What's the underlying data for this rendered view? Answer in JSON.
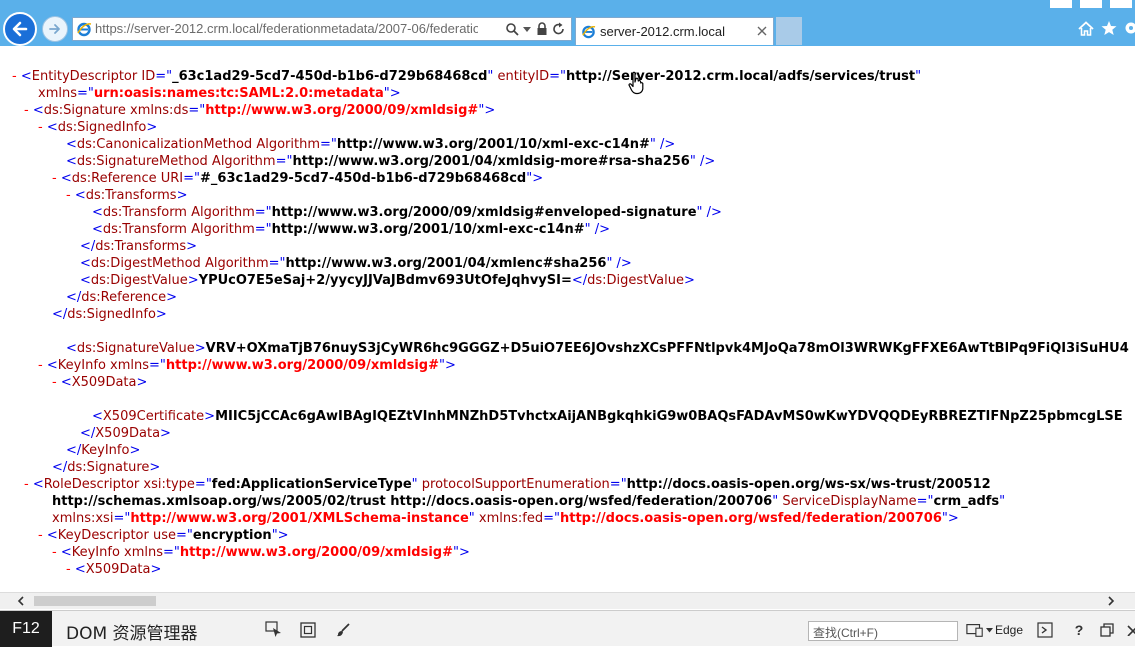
{
  "browser": {
    "address_url": "https://server-2012.crm.local/federationmetadata/2007-06/federation",
    "tab_title": "server-2012.crm.local"
  },
  "xml_lines": [
    [
      [
        "mk",
        "- "
      ],
      [
        "blue",
        "<"
      ],
      [
        "tg",
        "EntityDescriptor "
      ],
      [
        "atr",
        "ID"
      ],
      [
        "blue",
        "=\""
      ],
      [
        "vl",
        "_63c1ad29-5cd7-450d-b1b6-d729b68468cd"
      ],
      [
        "blue",
        "\" "
      ],
      [
        "atr",
        "entityID"
      ],
      [
        "blue",
        "=\""
      ],
      [
        "vl",
        "http://Server-2012.crm.local/adfs/services/trust"
      ],
      [
        "blue",
        "\""
      ]
    ],
    [
      [
        "atr",
        "xmlns"
      ],
      [
        "blue",
        "=\""
      ],
      [
        "ns",
        "urn:oasis:names:tc:SAML:2.0:metadata"
      ],
      [
        "blue",
        "\">"
      ]
    ],
    [
      [
        "mk",
        "- "
      ],
      [
        "blue",
        "<"
      ],
      [
        "tg",
        "ds:Signature "
      ],
      [
        "atr",
        "xmlns:ds"
      ],
      [
        "blue",
        "=\""
      ],
      [
        "ns",
        "http://www.w3.org/2000/09/xmldsig#"
      ],
      [
        "blue",
        "\">"
      ]
    ],
    [
      [
        "mk",
        "- "
      ],
      [
        "blue",
        "<"
      ],
      [
        "tg",
        "ds:SignedInfo"
      ],
      [
        "blue",
        ">"
      ]
    ],
    [
      [
        "blue",
        "<"
      ],
      [
        "tg",
        "ds:CanonicalizationMethod "
      ],
      [
        "atr",
        "Algorithm"
      ],
      [
        "blue",
        "=\""
      ],
      [
        "vl",
        "http://www.w3.org/2001/10/xml-exc-c14n#"
      ],
      [
        "blue",
        "\" />"
      ]
    ],
    [
      [
        "blue",
        "<"
      ],
      [
        "tg",
        "ds:SignatureMethod "
      ],
      [
        "atr",
        "Algorithm"
      ],
      [
        "blue",
        "=\""
      ],
      [
        "vl",
        "http://www.w3.org/2001/04/xmldsig-more#rsa-sha256"
      ],
      [
        "blue",
        "\" />"
      ]
    ],
    [
      [
        "mk",
        "- "
      ],
      [
        "blue",
        "<"
      ],
      [
        "tg",
        "ds:Reference "
      ],
      [
        "atr",
        "URI"
      ],
      [
        "blue",
        "=\""
      ],
      [
        "vl",
        "#_63c1ad29-5cd7-450d-b1b6-d729b68468cd"
      ],
      [
        "blue",
        "\">"
      ]
    ],
    [
      [
        "mk",
        "- "
      ],
      [
        "blue",
        "<"
      ],
      [
        "tg",
        "ds:Transforms"
      ],
      [
        "blue",
        ">"
      ]
    ],
    [
      [
        "blue",
        "<"
      ],
      [
        "tg",
        "ds:Transform "
      ],
      [
        "atr",
        "Algorithm"
      ],
      [
        "blue",
        "=\""
      ],
      [
        "vl",
        "http://www.w3.org/2000/09/xmldsig#enveloped-signature"
      ],
      [
        "blue",
        "\" />"
      ]
    ],
    [
      [
        "blue",
        "<"
      ],
      [
        "tg",
        "ds:Transform "
      ],
      [
        "atr",
        "Algorithm"
      ],
      [
        "blue",
        "=\""
      ],
      [
        "vl",
        "http://www.w3.org/2001/10/xml-exc-c14n#"
      ],
      [
        "blue",
        "\" />"
      ]
    ],
    [
      [
        "blue",
        "</"
      ],
      [
        "tg",
        "ds:Transforms"
      ],
      [
        "blue",
        ">"
      ]
    ],
    [
      [
        "blue",
        "<"
      ],
      [
        "tg",
        "ds:DigestMethod "
      ],
      [
        "atr",
        "Algorithm"
      ],
      [
        "blue",
        "=\""
      ],
      [
        "vl",
        "http://www.w3.org/2001/04/xmlenc#sha256"
      ],
      [
        "blue",
        "\" />"
      ]
    ],
    [
      [
        "blue",
        "<"
      ],
      [
        "tg",
        "ds:DigestValue"
      ],
      [
        "blue",
        ">"
      ],
      [
        "vl",
        "YPUcO7E5eSaj+2/yycyJJVaJBdmv693UtOfeJqhvySI="
      ],
      [
        "blue",
        "</"
      ],
      [
        "tg",
        "ds:DigestValue"
      ],
      [
        "blue",
        ">"
      ]
    ],
    [
      [
        "blue",
        "</"
      ],
      [
        "tg",
        "ds:Reference"
      ],
      [
        "blue",
        ">"
      ]
    ],
    [
      [
        "blue",
        "</"
      ],
      [
        "tg",
        "ds:SignedInfo"
      ],
      [
        "blue",
        ">"
      ]
    ],
    [
      [
        "blue",
        "<"
      ],
      [
        "tg",
        "ds:SignatureValue"
      ],
      [
        "blue",
        ">"
      ],
      [
        "vl",
        "VRV+OXmaTjB76nuyS3jCyWR6hc9GGGZ+D5uiO7EE6JOvshzXCsPFFNtlpvk4MJoQa78mOl3WRWKgFFXE6AwTtBlPq9FiQI3iSuHU4"
      ]
    ],
    [
      [
        "mk",
        "- "
      ],
      [
        "blue",
        "<"
      ],
      [
        "tg",
        "KeyInfo "
      ],
      [
        "atr",
        "xmlns"
      ],
      [
        "blue",
        "=\""
      ],
      [
        "ns",
        "http://www.w3.org/2000/09/xmldsig#"
      ],
      [
        "blue",
        "\">"
      ]
    ],
    [
      [
        "mk",
        "- "
      ],
      [
        "blue",
        "<"
      ],
      [
        "tg",
        "X509Data"
      ],
      [
        "blue",
        ">"
      ]
    ],
    [
      [
        "blue",
        "<"
      ],
      [
        "tg",
        "X509Certificate"
      ],
      [
        "blue",
        ">"
      ],
      [
        "vl",
        "MIIC5jCCAc6gAwIBAgIQEZtVInhMNZhD5TvhctxAijANBgkqhkiG9w0BAQsFADAvMS0wKwYDVQQDEyRBREZTIFNpZ25pbmcgLSE"
      ]
    ],
    [
      [
        "blue",
        "</"
      ],
      [
        "tg",
        "X509Data"
      ],
      [
        "blue",
        ">"
      ]
    ],
    [
      [
        "blue",
        "</"
      ],
      [
        "tg",
        "KeyInfo"
      ],
      [
        "blue",
        ">"
      ]
    ],
    [
      [
        "blue",
        "</"
      ],
      [
        "tg",
        "ds:Signature"
      ],
      [
        "blue",
        ">"
      ]
    ],
    [
      [
        "mk",
        "- "
      ],
      [
        "blue",
        "<"
      ],
      [
        "tg",
        "RoleDescriptor "
      ],
      [
        "atr",
        "xsi:type"
      ],
      [
        "blue",
        "=\""
      ],
      [
        "vl",
        "fed:ApplicationServiceType"
      ],
      [
        "blue",
        "\" "
      ],
      [
        "atr",
        "protocolSupportEnumeration"
      ],
      [
        "blue",
        "=\""
      ],
      [
        "vl",
        "http://docs.oasis-open.org/ws-sx/ws-trust/200512"
      ]
    ],
    [
      [
        "vl",
        "http://schemas.xmlsoap.org/ws/2005/02/trust http://docs.oasis-open.org/wsfed/federation/200706"
      ],
      [
        "blue",
        "\" "
      ],
      [
        "atr",
        "ServiceDisplayName"
      ],
      [
        "blue",
        "=\""
      ],
      [
        "vl",
        "crm_adfs"
      ],
      [
        "blue",
        "\""
      ]
    ],
    [
      [
        "atr",
        "xmlns:xsi"
      ],
      [
        "blue",
        "=\""
      ],
      [
        "ns",
        "http://www.w3.org/2001/XMLSchema-instance"
      ],
      [
        "blue",
        "\" "
      ],
      [
        "atr",
        "xmlns:fed"
      ],
      [
        "blue",
        "=\""
      ],
      [
        "ns",
        "http://docs.oasis-open.org/wsfed/federation/200706"
      ],
      [
        "blue",
        "\">"
      ]
    ],
    [
      [
        "mk",
        "- "
      ],
      [
        "blue",
        "<"
      ],
      [
        "tg",
        "KeyDescriptor "
      ],
      [
        "atr",
        "use"
      ],
      [
        "blue",
        "=\""
      ],
      [
        "vl",
        "encryption"
      ],
      [
        "blue",
        "\">"
      ]
    ],
    [
      [
        "mk",
        "- "
      ],
      [
        "blue",
        "<"
      ],
      [
        "tg",
        "KeyInfo "
      ],
      [
        "atr",
        "xmlns"
      ],
      [
        "blue",
        "=\""
      ],
      [
        "ns",
        "http://www.w3.org/2000/09/xmldsig#"
      ],
      [
        "blue",
        "\">"
      ]
    ],
    [
      [
        "mk",
        "- "
      ],
      [
        "blue",
        "<"
      ],
      [
        "tg",
        "X509Data"
      ],
      [
        "blue",
        ">"
      ]
    ],
    [
      [
        "blue",
        "<"
      ],
      [
        "tg",
        "X509Certificate"
      ],
      [
        "blue",
        ">"
      ],
      [
        "vl",
        "MIIC7DCCAdSgAwIBAgIQWECEAeHuWLtIzdmXCklRhTANBgkqhkiG9w0BAQsFADAyMTAwLgYDVQQDEydBREZTIEVuY3J5cHRp"
      ]
    ]
  ],
  "f12": {
    "key_label": "F12",
    "title": "DOM 资源管理器",
    "search_placeholder": "查找(Ctrl+F)",
    "emulation_label": "Edge",
    "help_label": "?"
  },
  "icons": [
    "back-arrow-icon",
    "forward-arrow-icon",
    "ie-logo-icon",
    "search-icon",
    "lock-icon",
    "refresh-icon",
    "close-icon",
    "home-icon",
    "favorites-star-icon",
    "settings-gear-icon",
    "select-element-icon",
    "highlight-element-icon",
    "brush-icon",
    "emulation-icon",
    "console-icon",
    "undock-icon",
    "close-devtools-icon",
    "hand-cursor-icon"
  ]
}
